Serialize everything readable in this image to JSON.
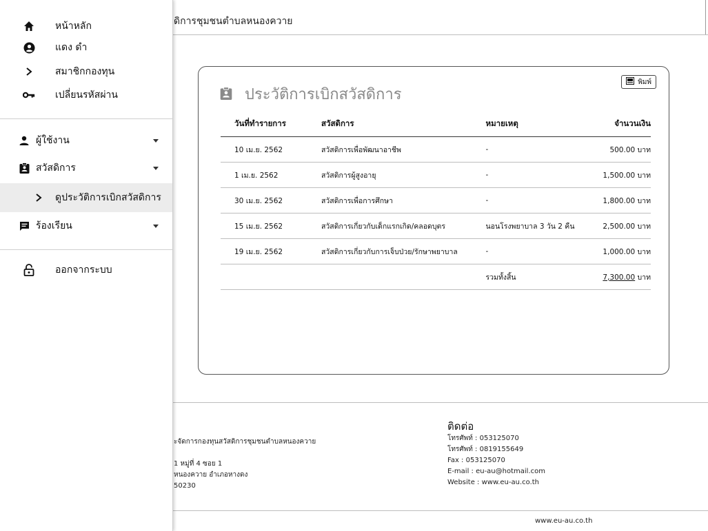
{
  "header": {
    "title": "ดิการชุมชนตำบลหนองควาย"
  },
  "sidebar": {
    "top": [
      {
        "icon": "home-icon",
        "label": "หน้าหลัก"
      },
      {
        "icon": "account-circle-icon",
        "label": "แดง ดำ"
      },
      {
        "icon": "chevron-right-icon",
        "label": "สมาชิกกองทุน"
      },
      {
        "icon": "key-icon",
        "label": "เปลี่ยนรหัสผ่าน"
      }
    ],
    "sections": [
      {
        "icon": "person-icon",
        "label": "ผู้ใช้งาน"
      },
      {
        "icon": "clipboard-icon",
        "label": "สวัสดิการ"
      },
      {
        "icon": "chevron-right-icon",
        "label": "ดูประวัติการเบิกสวัสดิการ"
      },
      {
        "icon": "feedback-icon",
        "label": "ร้องเรียน"
      }
    ],
    "logout": {
      "icon": "lock-open-icon",
      "label": "ออกจากระบบ"
    }
  },
  "card": {
    "title": "ประวัติการเบิกสวัสดิการ",
    "print_label": "พิมพ์",
    "columns": [
      "วันที่ทำรายการ",
      "สวัสดิการ",
      "หมายเหตุ",
      "จำนวนเงิน"
    ],
    "rows": [
      {
        "date": "10 เม.ย. 2562",
        "welfare": "สวัสดิการเพื่อพัฒนาอาชีพ",
        "note": "-",
        "amount": "500.00 บาท"
      },
      {
        "date": "1 เม.ย. 2562",
        "welfare": "สวัสดิการผู้สูงอายุ",
        "note": "-",
        "amount": "1,500.00 บาท"
      },
      {
        "date": "30 เม.ย. 2562",
        "welfare": "สวัสดิการเพื่อการศึกษา",
        "note": "-",
        "amount": "1,800.00 บาท"
      },
      {
        "date": "15 เม.ย. 2562",
        "welfare": "สวัสดิการเกี่ยวกับเด็กแรกเกิด/คลอดบุตร",
        "note": "นอนโรงพยาบาล 3 วัน 2 คืน",
        "amount": "2,500.00 บาท"
      },
      {
        "date": "19 เม.ย. 2562",
        "welfare": "สวัสดิการเกี่ยวกับการเจ็บป่วย/รักษาพยาบาล",
        "note": "-",
        "amount": "1,000.00 บาท"
      }
    ],
    "total_label": "รวมทั้งสิ้น",
    "total_value": "7,300.00",
    "total_unit": " บาท"
  },
  "footer": {
    "left_lines": [
      "ะจัดการกองทุนสวัสดิการชุมชนตำบลหนองควาย",
      "",
      "1 หมู่ที่ 4 ซอย 1",
      "หนองควาย อำเภอหางดง",
      "50230"
    ],
    "contact_title": "ติดต่อ",
    "contact_lines": [
      "โทรศัพท์ : 053125070",
      "โทรศัพท์ : 0819155649",
      "Fax : 053125070",
      "E-mail : eu-au@hotmail.com",
      "Website : www.eu-au.co.th"
    ],
    "bottom_url": "www.eu-au.co.th"
  }
}
